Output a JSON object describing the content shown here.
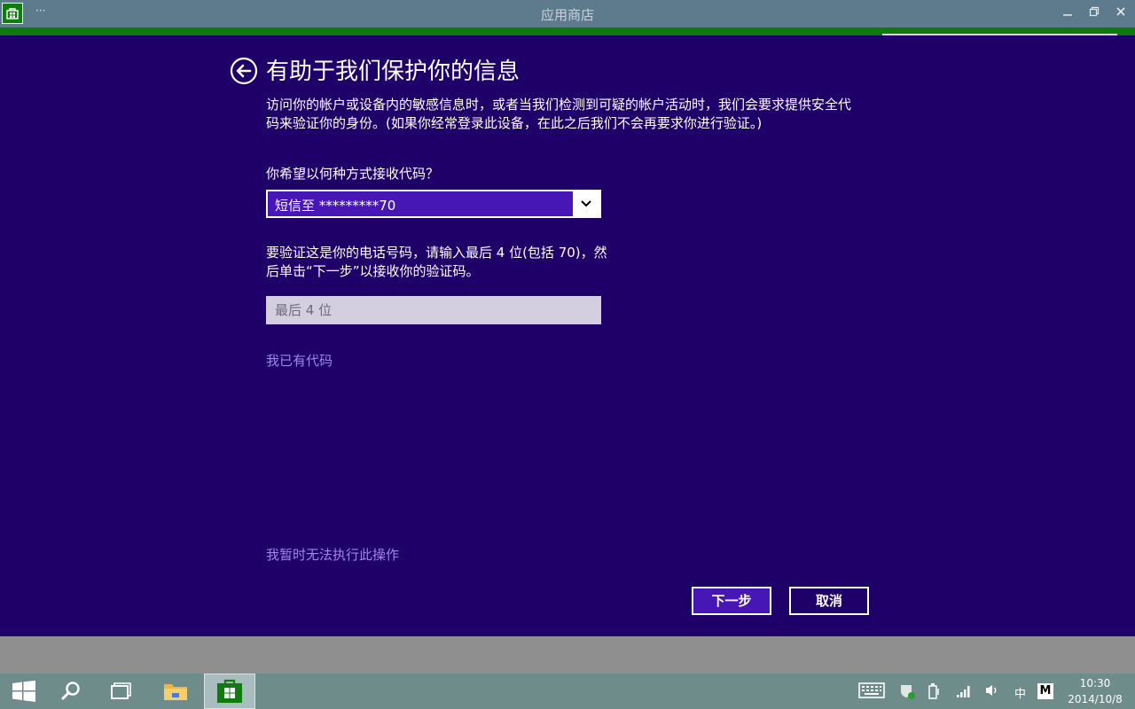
{
  "window": {
    "title": "应用商店",
    "menu_dots": "···"
  },
  "page": {
    "title": "有助于我们保护你的信息",
    "description": "访问你的帐户或设备内的敏感信息时，或者当我们检测到可疑的帐户活动时，我们会要求提供安全代码来验证你的身份。(如果你经常登录此设备，在此之后我们不会再要求你进行验证。)",
    "question": "你希望以何种方式接收代码？",
    "method_selected": "短信至 *********70",
    "verify_instructions": "要验证这是你的电话号码，请输入最后 4 位(包括 70)，然后单击“下一步”以接收你的验证码。",
    "digits_placeholder": "最后 4 位",
    "digits_value": "",
    "have_code_link": "我已有代码",
    "cant_do_link": "我暂时无法执行此操作",
    "next_button": "下一步",
    "cancel_button": "取消"
  },
  "taskbar": {
    "ime_lang": "中",
    "ime_mode": "M",
    "time": "10:30",
    "date": "2014/10/8"
  },
  "colors": {
    "background": "#1f0068",
    "accent": "#4617b4",
    "link": "#9f84ee",
    "store_green": "#0e7a0d"
  }
}
